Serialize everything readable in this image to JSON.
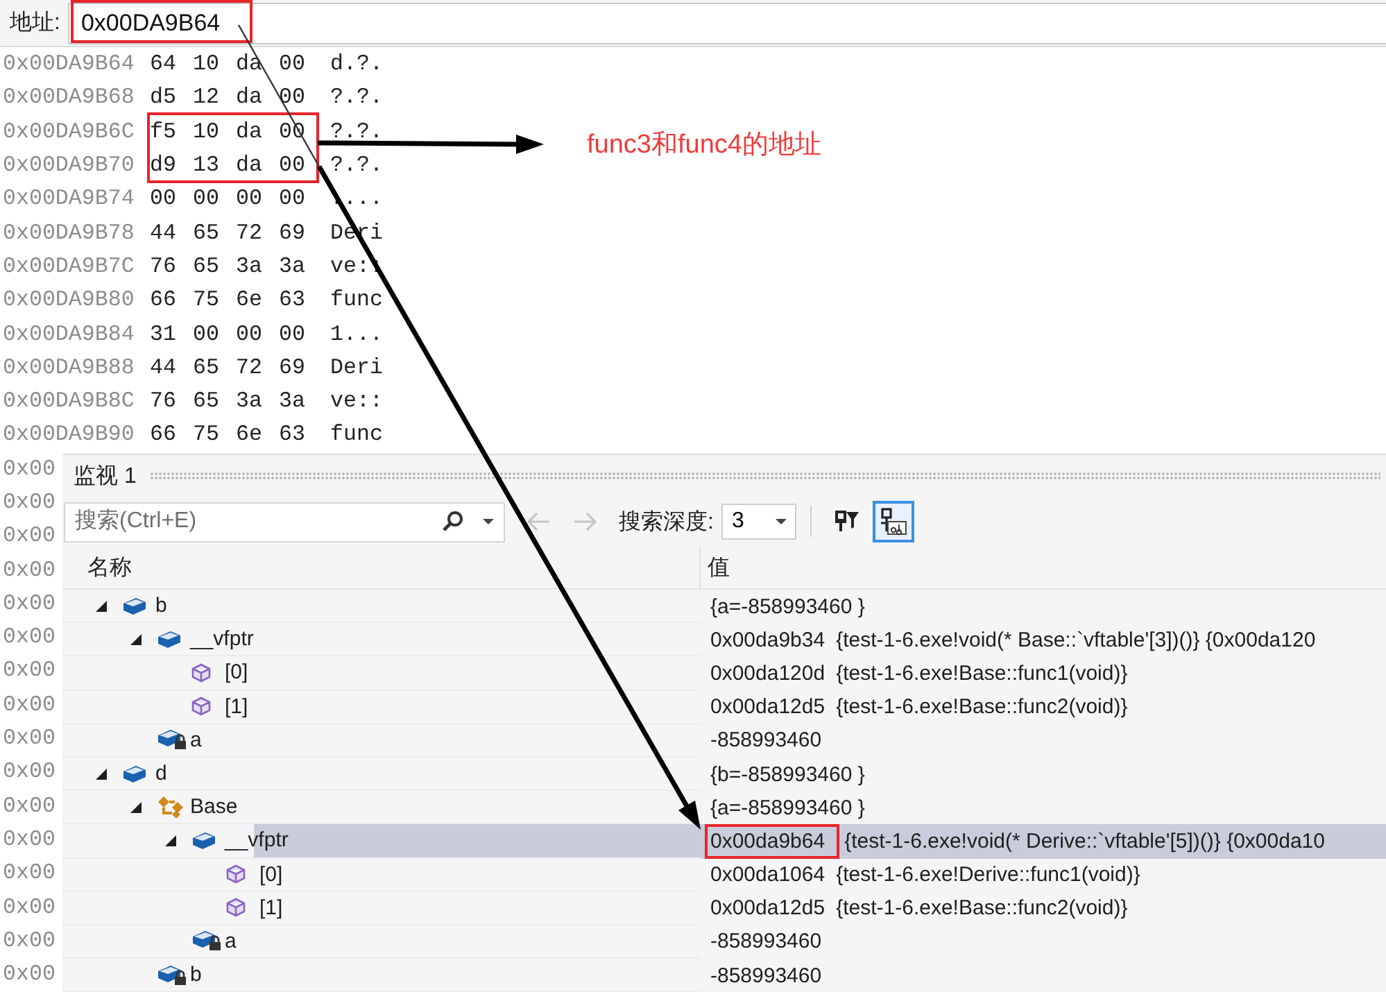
{
  "address_bar": {
    "label": "地址:",
    "value": "0x00DA9B64"
  },
  "memory_rows": [
    {
      "address": "0x00DA9B64",
      "bytes": [
        "64",
        "10",
        "da",
        "00"
      ],
      "ascii": "d.?."
    },
    {
      "address": "0x00DA9B68",
      "bytes": [
        "d5",
        "12",
        "da",
        "00"
      ],
      "ascii": "?.?."
    },
    {
      "address": "0x00DA9B6C",
      "bytes": [
        "f5",
        "10",
        "da",
        "00"
      ],
      "ascii": "?.?."
    },
    {
      "address": "0x00DA9B70",
      "bytes": [
        "d9",
        "13",
        "da",
        "00"
      ],
      "ascii": "?.?."
    },
    {
      "address": "0x00DA9B74",
      "bytes": [
        "00",
        "00",
        "00",
        "00"
      ],
      "ascii": "...."
    },
    {
      "address": "0x00DA9B78",
      "bytes": [
        "44",
        "65",
        "72",
        "69"
      ],
      "ascii": "Deri"
    },
    {
      "address": "0x00DA9B7C",
      "bytes": [
        "76",
        "65",
        "3a",
        "3a"
      ],
      "ascii": "ve::"
    },
    {
      "address": "0x00DA9B80",
      "bytes": [
        "66",
        "75",
        "6e",
        "63"
      ],
      "ascii": "func"
    },
    {
      "address": "0x00DA9B84",
      "bytes": [
        "31",
        "00",
        "00",
        "00"
      ],
      "ascii": "1..."
    },
    {
      "address": "0x00DA9B88",
      "bytes": [
        "44",
        "65",
        "72",
        "69"
      ],
      "ascii": "Deri"
    },
    {
      "address": "0x00DA9B8C",
      "bytes": [
        "76",
        "65",
        "3a",
        "3a"
      ],
      "ascii": "ve::"
    },
    {
      "address": "0x00DA9B90",
      "bytes": [
        "66",
        "75",
        "6e",
        "63"
      ],
      "ascii": "func"
    }
  ],
  "covered_addresses": [
    "0x00",
    "0x00",
    "0x00",
    "0x00",
    "0x00",
    "0x00",
    "0x00",
    "0x00",
    "0x00",
    "0x00",
    "0x00",
    "0x00",
    "0x00",
    "0x00",
    "0x00",
    "0x00"
  ],
  "annotation": {
    "text": "func3和func4的地址"
  },
  "watch_panel": {
    "title": "监视 1",
    "search": {
      "placeholder": "搜索(Ctrl+E)"
    },
    "back": {
      "disabled": true
    },
    "forward": {
      "disabled": true
    },
    "depth_label": "搜索深度:",
    "depth": "3",
    "format_button": {
      "selected": true
    },
    "columns": [
      "名称",
      "值"
    ],
    "rows": [
      {
        "name": "b",
        "kind": "object",
        "value": "{a=-858993460 }",
        "selected": false,
        "expanded": true,
        "children": [
          {
            "name": "__vfptr",
            "kind": "object",
            "value": "0x00da9b34",
            "detail": "{test-1-6.exe!void(* Base::`vftable'[3])()} {0x00da120",
            "selected": false,
            "expanded": true,
            "children": [
              {
                "name": "[0]",
                "kind": "method",
                "value": "0x00da120d",
                "detail": "{test-1-6.exe!Base::func1(void)}",
                "selected": false
              },
              {
                "name": "[1]",
                "kind": "method",
                "value": "0x00da12d5",
                "detail": "{test-1-6.exe!Base::func2(void)}",
                "selected": false
              }
            ]
          },
          {
            "name": "a",
            "kind": "private-field",
            "value": "-858993460",
            "selected": false
          }
        ]
      },
      {
        "name": "d",
        "kind": "object",
        "value": "{b=-858993460 }",
        "selected": false,
        "expanded": true,
        "children": [
          {
            "name": "Base",
            "kind": "base-class",
            "value": "{a=-858993460 }",
            "selected": false,
            "expanded": true,
            "children": [
              {
                "name": "__vfptr",
                "kind": "object",
                "value": "0x00da9b64",
                "detail": "{test-1-6.exe!void(* Derive::`vftable'[5])()} {0x00da10",
                "framed": true,
                "selected": true,
                "expanded": true,
                "children": [
                  {
                    "name": "[0]",
                    "kind": "method",
                    "value": "0x00da1064",
                    "detail": "{test-1-6.exe!Derive::func1(void)}",
                    "selected": false
                  },
                  {
                    "name": "[1]",
                    "kind": "method",
                    "value": "0x00da12d5",
                    "detail": "{test-1-6.exe!Base::func2(void)}",
                    "selected": false
                  }
                ]
              },
              {
                "name": "a",
                "kind": "private-field",
                "value": "-858993460",
                "selected": false
              }
            ]
          },
          {
            "name": "b",
            "kind": "private-field",
            "value": "-858993460",
            "selected": false
          }
        ]
      }
    ]
  }
}
